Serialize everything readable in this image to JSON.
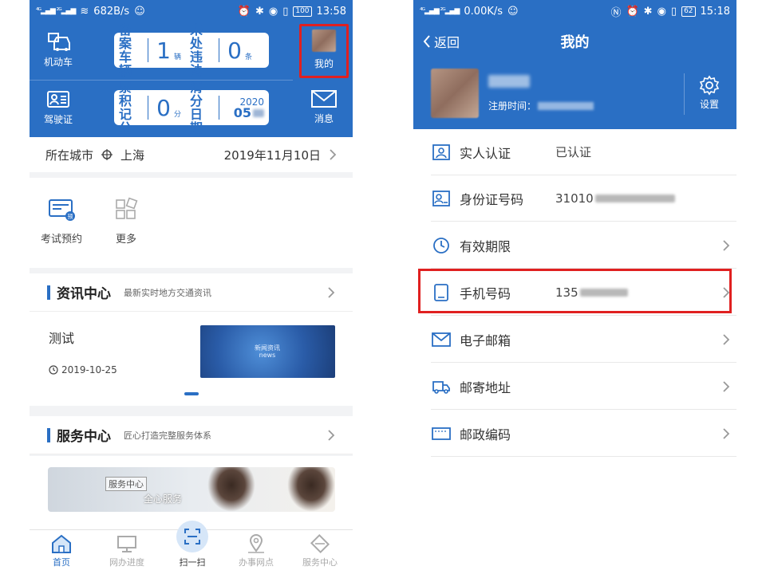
{
  "left": {
    "status": {
      "speed": "682B/s",
      "battery": "100",
      "time": "13:58"
    },
    "header": {
      "car_label": "机动车",
      "license_label": "驾驶证",
      "card1": {
        "label_a": "备案车辆",
        "num_a": "1",
        "unit_a": "辆",
        "label_b": "未处违法",
        "num_b": "0",
        "unit_b": "条"
      },
      "card2": {
        "label_a": "累积记分",
        "num_a": "0",
        "unit_a": "分",
        "label_b": "清分日期",
        "year_b": "2020",
        "date_b": "05"
      },
      "mine_label": "我的",
      "message_label": "消息"
    },
    "city": {
      "label": "所在城市",
      "city": "上海",
      "date": "2019年11月10日"
    },
    "grid": [
      {
        "label": "考试预约",
        "badge": "预"
      },
      {
        "label": "更多"
      }
    ],
    "news": {
      "title": "资讯中心",
      "subtitle": "最新实时地方交通资讯",
      "item_title": "测试",
      "item_date": "2019-10-25",
      "image_text_1": "新闻资讯",
      "image_text_2": "news"
    },
    "service": {
      "title": "服务中心",
      "subtitle": "匠心打造完整服务体系",
      "banner_tag": "服务中心",
      "banner_text": "全心服务"
    },
    "tabs": [
      {
        "label": "首页"
      },
      {
        "label": "网办进度"
      },
      {
        "label": "扫一扫"
      },
      {
        "label": "办事网点"
      },
      {
        "label": "服务中心"
      }
    ]
  },
  "right": {
    "status": {
      "speed": "0.00K/s",
      "battery": "62",
      "time": "15:18"
    },
    "nav": {
      "back_label": "返回",
      "title": "我的"
    },
    "profile": {
      "reg_label": "注册时间：",
      "settings_label": "设置"
    },
    "rows": [
      {
        "label": "实人认证",
        "value": "已认证"
      },
      {
        "label": "身份证号码",
        "value": "31010"
      },
      {
        "label": "有效期限",
        "value": ""
      },
      {
        "label": "手机号码",
        "value": "135"
      },
      {
        "label": "电子邮箱",
        "value": ""
      },
      {
        "label": "邮寄地址",
        "value": ""
      },
      {
        "label": "邮政编码",
        "value": ""
      }
    ]
  }
}
